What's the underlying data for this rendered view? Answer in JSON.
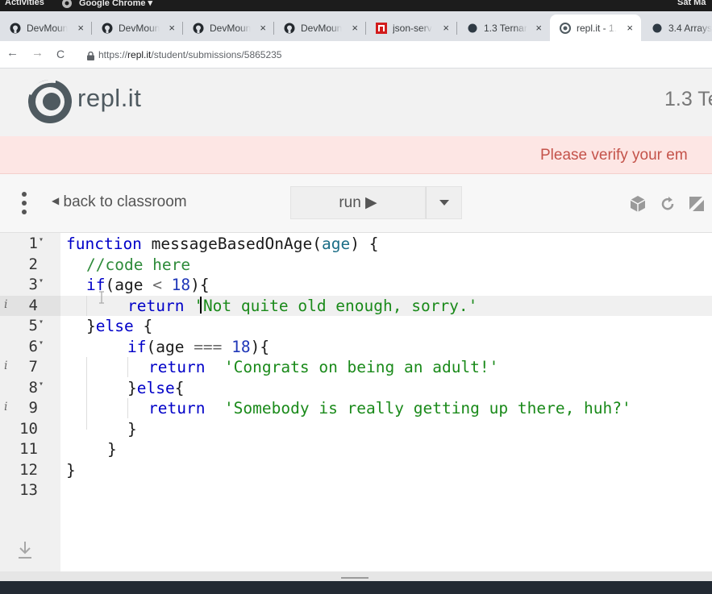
{
  "os_bar": {
    "activities": "Activities",
    "app_name": "Google Chrome ▾",
    "clock": "Sat Ma"
  },
  "tabs": [
    {
      "title": "DevMoun",
      "icon": "github-icon",
      "close": "×"
    },
    {
      "title": "DevMoun",
      "icon": "github-icon",
      "close": "×"
    },
    {
      "title": "DevMoun",
      "icon": "github-icon",
      "close": "×"
    },
    {
      "title": "DevMoun",
      "icon": "github-icon",
      "close": "×"
    },
    {
      "title": "json-serv",
      "icon": "json-server-icon",
      "close": "×"
    },
    {
      "title": "1.3 Ternar",
      "icon": "dot-icon",
      "close": "×"
    },
    {
      "title": "repl.it - 1.",
      "icon": "replit-icon",
      "close": "×",
      "active": true
    },
    {
      "title": "3.4 Arrays",
      "icon": "dot-icon"
    }
  ],
  "address_bar": {
    "back": "←",
    "forward": "→",
    "reload": "C",
    "url_scheme": "https://",
    "url_host": "repl.it",
    "url_path": "/student/submissions/5865235"
  },
  "header": {
    "logo_text": "repl.it",
    "title": "1.3 Te"
  },
  "banner": {
    "text": "Please verify your em"
  },
  "toolbar": {
    "menu_icon": "⋮",
    "back_label": "back to classroom",
    "run_label": "run ▶"
  },
  "editor": {
    "lines": [
      {
        "n": "1",
        "fold": true
      },
      {
        "n": "2"
      },
      {
        "n": "3",
        "fold": true
      },
      {
        "n": "4",
        "info": true,
        "current": true
      },
      {
        "n": "5",
        "fold": true
      },
      {
        "n": "6",
        "fold": true
      },
      {
        "n": "7",
        "info": true
      },
      {
        "n": "8",
        "fold": true
      },
      {
        "n": "9",
        "info": true
      },
      {
        "n": "10"
      },
      {
        "n": "11"
      },
      {
        "n": "12"
      },
      {
        "n": "13"
      }
    ],
    "tokens": {
      "l1_kw": "function",
      "l1_fn": " messageBasedOnAge(",
      "l1_var": "age",
      "l1_end": ") {",
      "l2_com": "//code here",
      "l3_kw": "if",
      "l3_a": "(age ",
      "l3_op": "<",
      "l3_num": " 18",
      "l3_end": "){",
      "l4_kw": "return",
      "l4_str": "'Not quite old enough, sorry.'",
      "l5_a": "}",
      "l5_kw": "else",
      "l5_end": " {",
      "l6_kw": "if",
      "l6_a": "(age ",
      "l6_op": "===",
      "l6_num": " 18",
      "l6_end": "){",
      "l7_kw": "return",
      "l7_str": "'Congrats on being an adult!'",
      "l8_a": "}",
      "l8_kw": "else",
      "l8_end": "{",
      "l9_kw": "return",
      "l9_str": "'Somebody is really getting up there, huh?'",
      "l10": "}",
      "l11": "}",
      "l12": "}"
    },
    "fold_marker": "▾",
    "info_marker": "i"
  }
}
